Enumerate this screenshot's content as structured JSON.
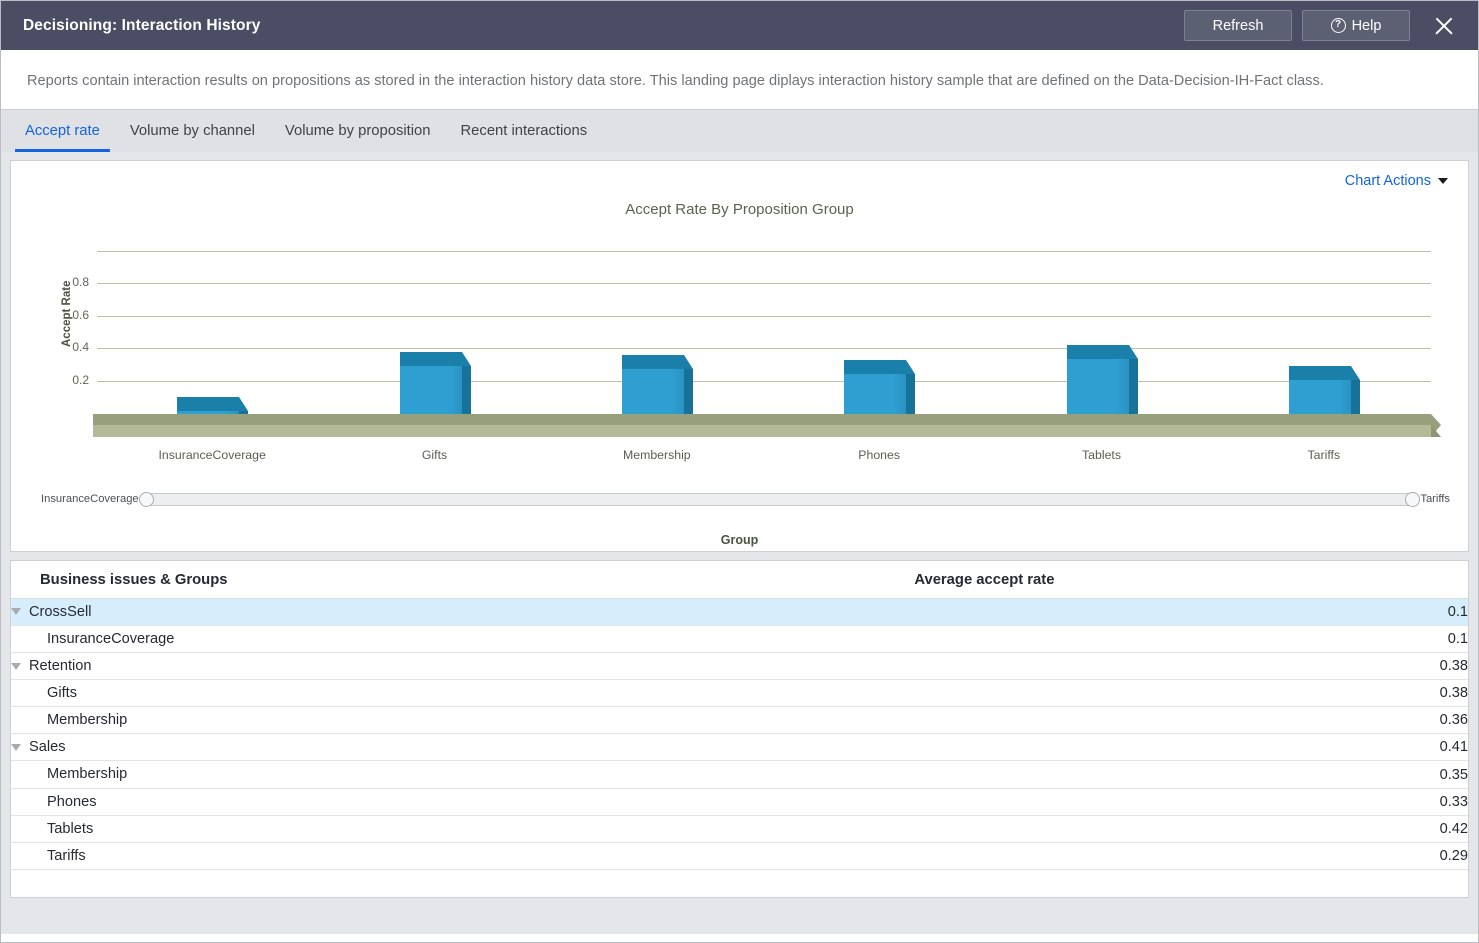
{
  "window": {
    "title": "Decisioning: Interaction History",
    "refresh_label": "Refresh",
    "help_label": "Help",
    "close_label": "Close"
  },
  "description": "Reports contain interaction results on propositions as stored in the interaction history data store. This landing page diplays interaction history sample that are defined on the Data-Decision-IH-Fact class.",
  "tabs": [
    {
      "label": "Accept rate",
      "active": true
    },
    {
      "label": "Volume by channel",
      "active": false
    },
    {
      "label": "Volume by proposition",
      "active": false
    },
    {
      "label": "Recent interactions",
      "active": false
    }
  ],
  "chart_panel": {
    "chart_actions_label": "Chart Actions",
    "range_left_label": "InsuranceCoverage",
    "range_right_label": "Tariffs"
  },
  "chart_data": {
    "type": "bar",
    "title": "Accept Rate By Proposition Group",
    "xlabel": "Group",
    "ylabel": "Accept Rate",
    "categories": [
      "InsuranceCoverage",
      "Gifts",
      "Membership",
      "Phones",
      "Tablets",
      "Tariffs"
    ],
    "values": [
      0.1,
      0.38,
      0.36,
      0.33,
      0.42,
      0.29
    ],
    "yticks": [
      "0.2",
      "0.4",
      "0.6",
      "0.8"
    ],
    "ytick_values": [
      0.2,
      0.4,
      0.6,
      0.8
    ],
    "ylim": [
      0,
      1.0
    ],
    "gridlines": [
      0.2,
      0.4,
      0.6,
      0.8,
      1.0
    ],
    "grid": true,
    "legend": "none",
    "bar_color": "#2f9fd2",
    "bar_top_color": "#1a7fa9",
    "bar_side_color": "#17729a",
    "floor_color": "#97a07c",
    "gridline_color": "#b8c4a4"
  },
  "table": {
    "headers": {
      "name": "Business issues & Groups",
      "rate": "Average accept rate"
    },
    "rows": [
      {
        "name": "CrossSell",
        "rate": "0.1",
        "type": "group",
        "selected": true
      },
      {
        "name": "InsuranceCoverage",
        "rate": "0.1",
        "type": "child",
        "selected": false
      },
      {
        "name": "Retention",
        "rate": "0.38",
        "type": "group",
        "selected": false
      },
      {
        "name": "Gifts",
        "rate": "0.38",
        "type": "child",
        "selected": false
      },
      {
        "name": "Membership",
        "rate": "0.36",
        "type": "child",
        "selected": false
      },
      {
        "name": "Sales",
        "rate": "0.41",
        "type": "group",
        "selected": false
      },
      {
        "name": "Membership",
        "rate": "0.35",
        "type": "child",
        "selected": false
      },
      {
        "name": "Phones",
        "rate": "0.33",
        "type": "child",
        "selected": false
      },
      {
        "name": "Tablets",
        "rate": "0.42",
        "type": "child",
        "selected": false
      },
      {
        "name": "Tariffs",
        "rate": "0.29",
        "type": "child",
        "selected": false
      }
    ]
  },
  "colors": {
    "titlebar": "#4a4d63",
    "accent": "#1464e0",
    "selected_row": "#d6eefb"
  }
}
